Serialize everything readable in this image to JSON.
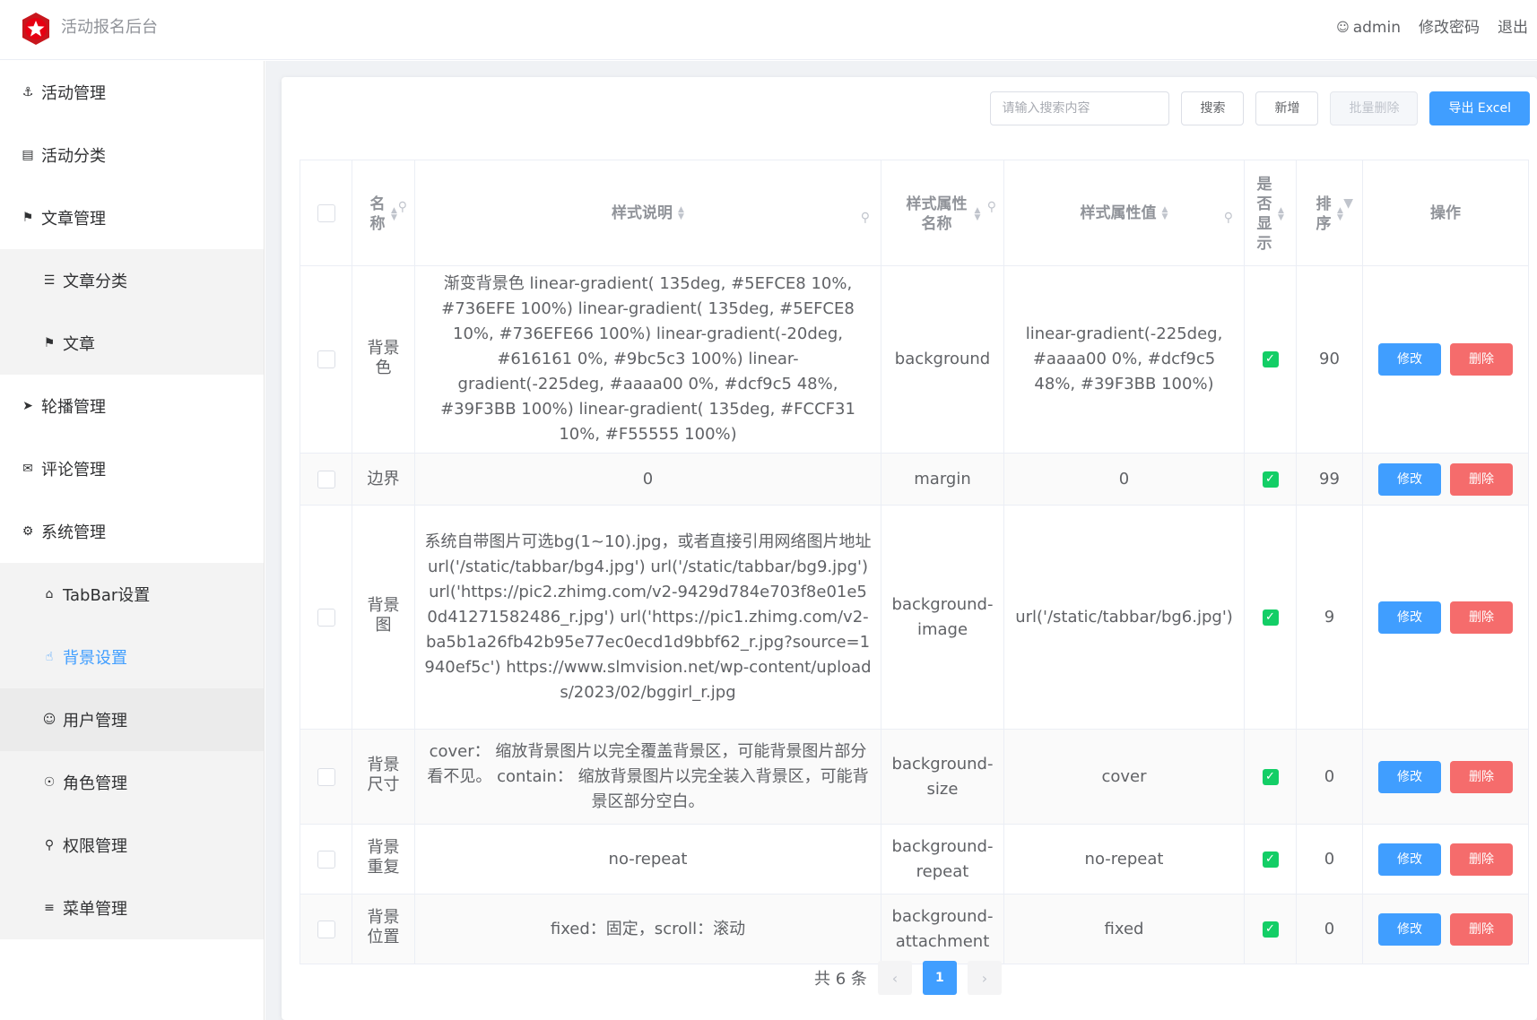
{
  "header": {
    "app_title": "活动报名后台",
    "user": "admin",
    "change_password": "修改密码",
    "logout": "退出"
  },
  "sidebar": {
    "items": [
      {
        "label": "活动管理",
        "icon": "anchor-icon"
      },
      {
        "label": "活动分类",
        "icon": "ticket-icon"
      },
      {
        "label": "文章管理",
        "icon": "flag-icon"
      },
      {
        "label": "文章分类",
        "icon": "list-icon"
      },
      {
        "label": "文章",
        "icon": "flag-icon"
      },
      {
        "label": "轮播管理",
        "icon": "send-icon"
      },
      {
        "label": "评论管理",
        "icon": "chat-icon"
      },
      {
        "label": "系统管理",
        "icon": "gear-icon"
      },
      {
        "label": "TabBar设置",
        "icon": "home-icon"
      },
      {
        "label": "背景设置",
        "icon": "thumb-up-icon"
      },
      {
        "label": "用户管理",
        "icon": "user-icon"
      },
      {
        "label": "角色管理",
        "icon": "role-icon"
      },
      {
        "label": "权限管理",
        "icon": "lock-icon"
      },
      {
        "label": "菜单管理",
        "icon": "menu-icon"
      }
    ]
  },
  "toolbar": {
    "search_placeholder": "请输入搜索内容",
    "search": "搜索",
    "add": "新增",
    "batch_delete": "批量删除",
    "export": "导出 Excel"
  },
  "table": {
    "headers": {
      "name": "名称",
      "desc": "样式说明",
      "prop_name": "样式属性名称",
      "prop_value": "样式属性值",
      "show": "是否显示",
      "order": "排序",
      "ops": "操作"
    },
    "rows": [
      {
        "name": "背景色",
        "desc": "渐变背景色 linear-gradient( 135deg, #5EFCE8 10%, #736EFE 100%) linear-gradient( 135deg, #5EFCE8 10%, #736EFE66 100%) linear-gradient(-20deg, #616161 0%, #9bc5c3 100%) linear-gradient(-225deg, #aaaa00 0%, #dcf9c5 48%, #39F3BB 100%) linear-gradient( 135deg, #FCCF31 10%, #F55555 100%)",
        "prop_name": "background",
        "prop_value": "linear-gradient(-225deg, #aaaa00 0%, #dcf9c5 48%, #39F3BB 100%)",
        "order": "90"
      },
      {
        "name": "边界",
        "desc": "0",
        "prop_name": "margin",
        "prop_value": "0",
        "order": "99"
      },
      {
        "name": "背景图",
        "desc": "系统自带图片可选bg(1~10).jpg，或者直接引用网络图片地址 url('/static/tabbar/bg4.jpg') url('/static/tabbar/bg9.jpg') url('https://pic2.zhimg.com/v2-9429d784e703f8e01e50d41271582486_r.jpg') url('https://pic1.zhimg.com/v2-ba5b1a26fb42b95e77ec0ecd1d9bbf62_r.jpg?source=1940ef5c') https://www.slmvision.net/wp-content/uploads/2023/02/bggirl_r.jpg",
        "prop_name": "background-image",
        "prop_value": "url('/static/tabbar/bg6.jpg')",
        "order": "9"
      },
      {
        "name": "背景尺寸",
        "desc": "cover： 缩放背景图片以完全覆盖背景区，可能背景图片部分看不见。 contain： 缩放背景图片以完全装入背景区，可能背景区部分空白。",
        "prop_name": "background-size",
        "prop_value": "cover",
        "order": "0"
      },
      {
        "name": "背景重复",
        "desc": "no-repeat",
        "prop_name": "background-repeat",
        "prop_value": "no-repeat",
        "order": "0"
      },
      {
        "name": "背景位置",
        "desc": "fixed：固定，scroll：滚动",
        "prop_name": "background-attachment",
        "prop_value": "fixed",
        "order": "0"
      }
    ],
    "edit_label": "修改",
    "delete_label": "删除"
  },
  "pagination": {
    "total": "共 6 条",
    "current": "1"
  },
  "colors": {
    "primary": "#409eff",
    "danger": "#f56c6c",
    "success": "#13ce66",
    "logo": "#d4111a"
  }
}
